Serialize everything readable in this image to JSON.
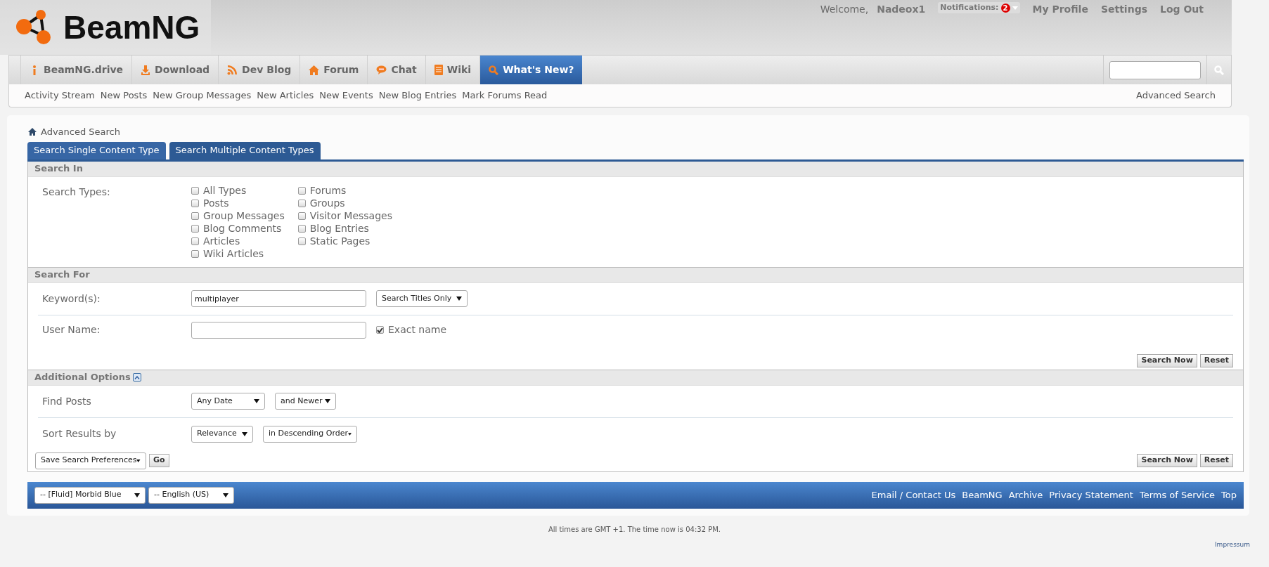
{
  "header": {
    "logo_text": "BeamNG",
    "welcome": "Welcome,",
    "username": "Nadeox1",
    "notifications": {
      "label": "Notifications:",
      "count": "2"
    },
    "links": [
      "My Profile",
      "Settings",
      "Log Out"
    ]
  },
  "nav": {
    "tabs": [
      {
        "label": "BeamNG.drive",
        "kind": "info",
        "selected": false
      },
      {
        "label": "Download",
        "kind": "download",
        "selected": false
      },
      {
        "label": "Dev Blog",
        "kind": "rss",
        "selected": false
      },
      {
        "label": "Forum",
        "kind": "home",
        "selected": false
      },
      {
        "label": "Chat",
        "kind": "chat",
        "selected": false
      },
      {
        "label": "Wiki",
        "kind": "doc",
        "selected": false
      },
      {
        "label": "What's New?",
        "kind": "search",
        "selected": true
      }
    ]
  },
  "subnav": {
    "links": [
      "Activity Stream",
      "New Posts",
      "New Group Messages",
      "New Articles",
      "New Events",
      "New Blog Entries",
      "Mark Forums Read"
    ],
    "right_link": "Advanced Search"
  },
  "breadcrumb": "Advanced Search",
  "tabs": [
    {
      "label": "Search Single Content Type",
      "selected": false
    },
    {
      "label": "Search Multiple Content Types",
      "selected": true
    }
  ],
  "search_in": {
    "title": "Search In",
    "label": "Search Types:",
    "columns": [
      [
        {
          "label": "All Types",
          "checked": false
        },
        {
          "label": "Posts",
          "checked": false
        },
        {
          "label": "Group Messages",
          "checked": false
        },
        {
          "label": "Blog Comments",
          "checked": false
        },
        {
          "label": "Articles",
          "checked": false
        },
        {
          "label": "Wiki Articles",
          "checked": false
        }
      ],
      [
        {
          "label": "Forums",
          "checked": false
        },
        {
          "label": "Groups",
          "checked": false
        },
        {
          "label": "Visitor Messages",
          "checked": false
        },
        {
          "label": "Blog Entries",
          "checked": false
        },
        {
          "label": "Static Pages",
          "checked": false
        }
      ]
    ]
  },
  "search_for": {
    "title": "Search For",
    "keyword": {
      "label": "Keyword(s):",
      "value": "multiplayer",
      "select": "Search Titles Only"
    },
    "username": {
      "label": "User Name:",
      "exact": {
        "label": "Exact name",
        "checked": true
      }
    },
    "buttons": [
      "Search Now",
      "Reset"
    ]
  },
  "additional": {
    "title": "Additional Options",
    "expanded": true,
    "rows": [
      {
        "label": "Find Posts",
        "selects": [
          "Any Date",
          "and Newer"
        ]
      },
      {
        "label": "Sort Results by",
        "selects": [
          "Relevance",
          "in Descending Order"
        ]
      }
    ],
    "save_select": "Save Search Preferences",
    "go": "Go",
    "buttons": [
      "Search Now",
      "Reset"
    ]
  },
  "footer": {
    "selects": [
      "-- [Fluid] Morbid Blue",
      "-- English (US)"
    ],
    "links": [
      "Email / Contact Us",
      "BeamNG",
      "Archive",
      "Privacy Statement",
      "Terms of Service",
      "Top"
    ]
  },
  "time_text": "All times are GMT +1. The time now is 04:32 PM.",
  "impressum": "Impressum"
}
